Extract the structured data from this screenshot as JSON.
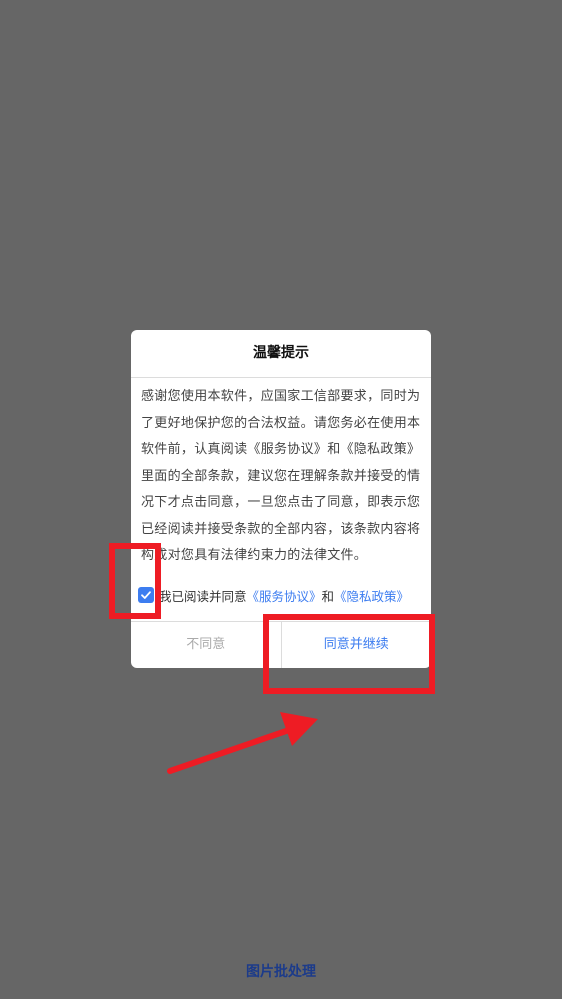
{
  "dialog": {
    "title": "温馨提示",
    "body": "感谢您使用本软件，应国家工信部要求，同时为了更好地保护您的合法权益。请您务必在使用本软件前，认真阅读《服务协议》和《隐私政策》里面的全部条款，建议您在理解条款并接受的情况下才点击同意，一旦您点击了同意，即表示您已经阅读并接受条款的全部内容，该条款内容将构成对您具有法律约束力的法律文件。",
    "agree": {
      "checked": true,
      "prefix": "我已阅读并同意",
      "service_link": "《服务协议》",
      "conjunction": "和",
      "privacy_link": "《隐私政策》"
    },
    "decline_label": "不同意",
    "accept_label": "同意并继续"
  },
  "bottom_label": "图片批处理",
  "colors": {
    "overlay": "#666666",
    "accent": "#3d7df0",
    "highlight": "#ee1c24",
    "bottom_label": "#1c3b8a"
  },
  "icons": {
    "checkbox": "check-icon"
  }
}
